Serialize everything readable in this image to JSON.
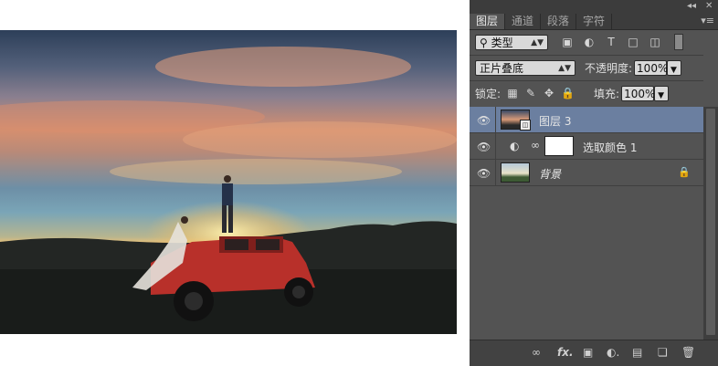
{
  "panel": {
    "topbar": {
      "collapse_icon": "double-chevron-left",
      "close_icon": "close"
    },
    "tabs": [
      {
        "label": "图层",
        "active": true
      },
      {
        "label": "通道",
        "active": false
      },
      {
        "label": "段落",
        "active": false
      },
      {
        "label": "字符",
        "active": false
      }
    ],
    "filter": {
      "kind_label": "类型"
    },
    "blend_mode": "正片叠底",
    "opacity": {
      "label": "不透明度:",
      "value": "100%"
    },
    "lock": {
      "label": "锁定:"
    },
    "fill": {
      "label": "填充:",
      "value": "100%"
    },
    "layers": [
      {
        "name": "图层 3",
        "type": "smart-object",
        "selected": true
      },
      {
        "name": "选取颜色 1",
        "type": "adjustment",
        "selected": false
      },
      {
        "name": "背景",
        "type": "background",
        "selected": false,
        "locked": true
      }
    ],
    "bottom_icons": [
      "link",
      "fx",
      "mask",
      "adjustment",
      "folder",
      "new-layer",
      "trash"
    ],
    "accent_color": "#6b7fa0"
  },
  "photo": {
    "subject": "couple on red SUV at sunset"
  }
}
